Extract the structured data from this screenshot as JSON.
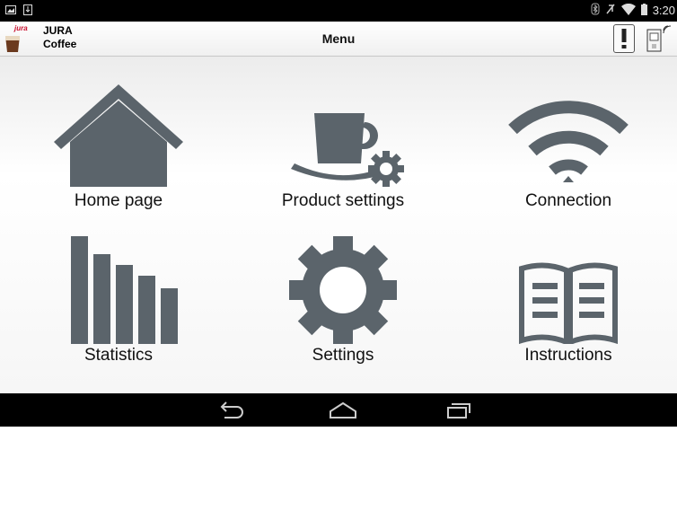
{
  "status_bar": {
    "time": "3:20"
  },
  "app_bar": {
    "brand_line1": "JURA",
    "brand_line2": "Coffee",
    "title": "Menu"
  },
  "menu": [
    {
      "label": "Home page",
      "icon": "house-icon"
    },
    {
      "label": "Product settings",
      "icon": "cup-gear-icon"
    },
    {
      "label": "Connection",
      "icon": "wifi-icon"
    },
    {
      "label": "Statistics",
      "icon": "bar-chart-icon"
    },
    {
      "label": "Settings",
      "icon": "gear-icon"
    },
    {
      "label": "Instructions",
      "icon": "book-icon"
    }
  ],
  "nav_bar": {
    "icons": [
      "back-icon",
      "home-icon",
      "recent-apps-icon"
    ]
  },
  "colors": {
    "icon": "#5b646b",
    "status_bar": "#000000",
    "nav_bar": "#000000"
  }
}
